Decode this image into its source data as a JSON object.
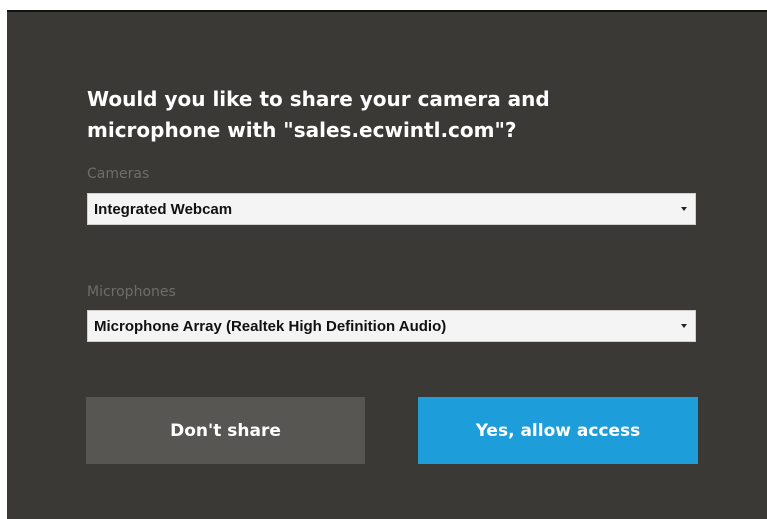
{
  "dialog": {
    "title": "Would you like to share your camera and microphone with \"sales.ecwintl.com\"?"
  },
  "cameras": {
    "label": "Cameras",
    "selected": "Integrated Webcam"
  },
  "microphones": {
    "label": "Microphones",
    "selected": "Microphone Array (Realtek High Definition Audio)"
  },
  "buttons": {
    "deny_label": "Don't share",
    "allow_label": "Yes, allow access"
  },
  "colors": {
    "dialog_background": "#3a3936",
    "deny_button": "#575653",
    "allow_button": "#1e9ddb"
  }
}
